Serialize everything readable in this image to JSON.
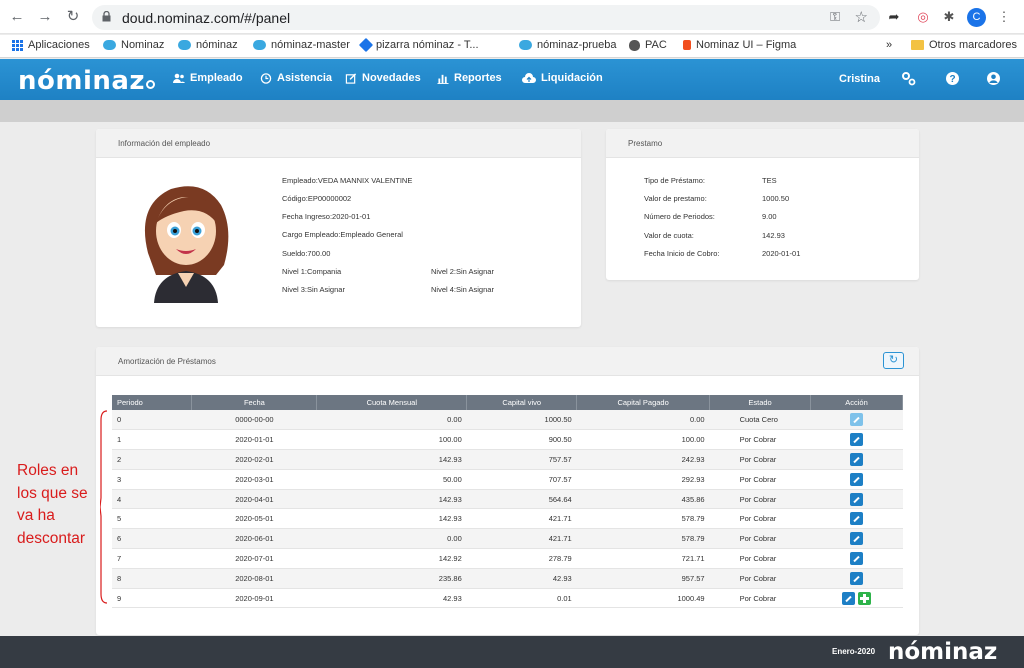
{
  "browser": {
    "url": "doud.nominaz.com/#/panel",
    "profile_initial": "C",
    "bookmarks": [
      "Aplicaciones",
      "Nominaz",
      "nóminaz",
      "nóminaz-master",
      "pizarra nóminaz - T...",
      "nóminaz-prueba",
      "PAC",
      "Nominaz UI – Figma"
    ],
    "more": "»",
    "other_bookmarks": "Otros marcadores"
  },
  "app": {
    "logo": "nóminaz",
    "menu": [
      "Empleado",
      "Asistencia",
      "Novedades",
      "Reportes",
      "Liquidación"
    ],
    "user": "Cristina"
  },
  "employee": {
    "title": "Información del empleado",
    "name": "Empleado:VEDA MANNIX VALENTINE",
    "code": "Código:EP00000002",
    "hire_date": "Fecha Ingreso:2020-01-01",
    "position": "Cargo Empleado:Empleado General",
    "salary": "Sueldo:700.00",
    "level1": "Nivel 1:Compania",
    "level2": "Nivel 2:Sin Asignar",
    "level3": "Nivel 3:Sin Asignar",
    "level4": "Nivel 4:Sin Asignar"
  },
  "loan": {
    "title": "Prestamo",
    "labels": [
      "Tipo de Préstamo:",
      "Valor de prestamo:",
      "Número de Periodos:",
      "Valor de cuota:",
      "Fecha Inicio de Cobro:"
    ],
    "values": [
      "TES",
      "1000.50",
      "9.00",
      "142.93",
      "2020-01-01"
    ]
  },
  "amortization": {
    "title": "Amortización de Préstamos",
    "headers": [
      "Periodo",
      "Fecha",
      "Cuota Mensual",
      "Capital vivo",
      "Capital Pagado",
      "Estado",
      "Acción"
    ],
    "rows": [
      [
        "0",
        "0000-00-00",
        "0.00",
        "1000.50",
        "0.00",
        "Cuota Cero"
      ],
      [
        "1",
        "2020-01-01",
        "100.00",
        "900.50",
        "100.00",
        "Por Cobrar"
      ],
      [
        "2",
        "2020-02-01",
        "142.93",
        "757.57",
        "242.93",
        "Por Cobrar"
      ],
      [
        "3",
        "2020-03-01",
        "50.00",
        "707.57",
        "292.93",
        "Por Cobrar"
      ],
      [
        "4",
        "2020-04-01",
        "142.93",
        "564.64",
        "435.86",
        "Por Cobrar"
      ],
      [
        "5",
        "2020-05-01",
        "142.93",
        "421.71",
        "578.79",
        "Por Cobrar"
      ],
      [
        "6",
        "2020-06-01",
        "0.00",
        "421.71",
        "578.79",
        "Por Cobrar"
      ],
      [
        "7",
        "2020-07-01",
        "142.92",
        "278.79",
        "721.71",
        "Por Cobrar"
      ],
      [
        "8",
        "2020-08-01",
        "235.86",
        "42.93",
        "957.57",
        "Por Cobrar"
      ],
      [
        "9",
        "2020-09-01",
        "42.93",
        "0.01",
        "1000.49",
        "Por Cobrar"
      ]
    ]
  },
  "annotation": [
    "Roles en",
    "los que se",
    "va ha",
    "descontar"
  ],
  "footer": {
    "date": "Enero-2020",
    "logo": "nóminaz"
  },
  "colors": {
    "header_blue": "#1e81c4",
    "table_header": "#6c7682",
    "annotation_red": "#d91c1c",
    "footer": "#353b43"
  }
}
